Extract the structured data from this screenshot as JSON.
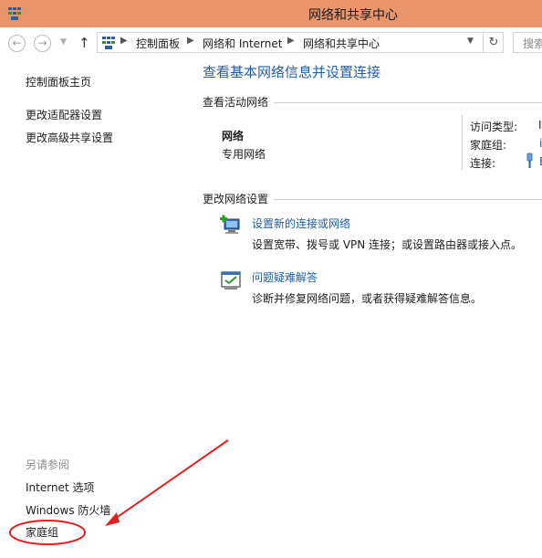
{
  "window": {
    "title": "网络和共享中心"
  },
  "addressbar": {
    "crumbs": [
      "控制面板",
      "网络和 Internet",
      "网络和共享中心"
    ],
    "search_placeholder": "搜索"
  },
  "icons": {
    "app": "network-center-icon",
    "back": "back-arrow-icon",
    "forward": "forward-arrow-icon",
    "up": "up-arrow-icon",
    "refresh": "refresh-icon",
    "new_connection": "new-connection-icon",
    "troubleshoot": "troubleshoot-icon",
    "wired": "ethernet-icon"
  },
  "sidebar": {
    "home": "控制面板主页",
    "items": [
      "更改适配器设置",
      "更改高级共享设置"
    ],
    "see_also_heading": "另请参阅",
    "see_also": [
      "Internet 选项",
      "Windows 防火墙",
      "家庭组"
    ]
  },
  "main": {
    "title": "查看基本网络信息并设置连接",
    "active_networks_heading": "查看活动网络",
    "network": {
      "name": "网络",
      "category": "专用网络",
      "access_type_label": "访问类型:",
      "access_type_value": "I",
      "homegroup_label": "家庭组:",
      "homegroup_value": "i",
      "connections_label": "连接:",
      "connections_value": "E"
    },
    "change_settings_heading": "更改网络设置",
    "tasks": [
      {
        "link": "设置新的连接或网络",
        "desc": "设置宽带、拨号或 VPN 连接；或设置路由器或接入点。"
      },
      {
        "link": "问题疑难解答",
        "desc": "诊断并修复网络问题，或者获得疑难解答信息。"
      }
    ]
  },
  "colors": {
    "titlebar": "#e9956b",
    "link": "#1f5fa5",
    "annotation": "#e02020"
  }
}
